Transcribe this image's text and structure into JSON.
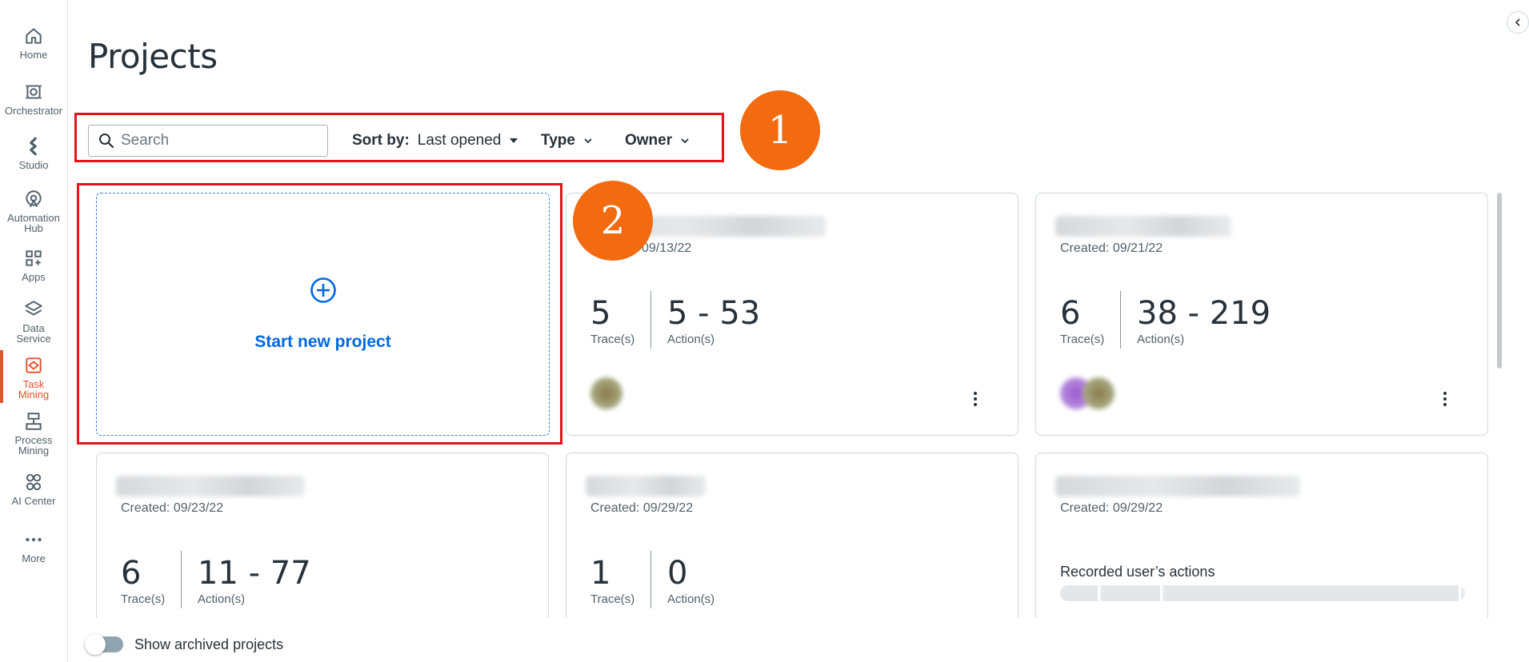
{
  "nav": {
    "items": [
      {
        "label": "Home",
        "icon": "home-icon"
      },
      {
        "label": "Orchestrator",
        "icon": "orchestrator-icon"
      },
      {
        "label": "Studio",
        "icon": "studio-icon"
      },
      {
        "label": "Automation\nHub",
        "icon": "automation-hub-icon"
      },
      {
        "label": "Apps",
        "icon": "apps-icon"
      },
      {
        "label": "Data\nService",
        "icon": "data-service-icon"
      },
      {
        "label": "Task\nMining",
        "icon": "task-mining-icon"
      },
      {
        "label": "Process\nMining",
        "icon": "process-mining-icon"
      },
      {
        "label": "AI Center",
        "icon": "ai-center-icon"
      },
      {
        "label": "More",
        "icon": "more-icon"
      }
    ],
    "active": "Task Mining",
    "accent_color": "#e0542b"
  },
  "page": {
    "title": "Projects"
  },
  "filters": {
    "search_placeholder": "Search",
    "sort_label": "Sort by:",
    "sort_value": "Last opened",
    "type_label": "Type",
    "owner_label": "Owner"
  },
  "annotations": {
    "badge_1": "1",
    "badge_2": "2",
    "highlight_color": "#e8121c",
    "badge_color": "#f26b10"
  },
  "new_project": {
    "label": "Start new project",
    "icon": "plus-circle-icon"
  },
  "projects": [
    {
      "created": "09/13/22",
      "traces": "5",
      "traces_label": "Trace(s)",
      "actions": "5 - 53",
      "actions_label": "Action(s)"
    },
    {
      "created": "Created: 09/21/22",
      "traces": "6",
      "traces_label": "Trace(s)",
      "actions": "38 - 219",
      "actions_label": "Action(s)"
    },
    {
      "created": "Created: 09/23/22",
      "traces": "6",
      "traces_label": "Trace(s)",
      "actions": "11 - 77",
      "actions_label": "Action(s)"
    },
    {
      "created": "Created: 09/29/22",
      "traces": "1",
      "traces_label": "Trace(s)",
      "actions": "0",
      "actions_label": "Action(s)"
    },
    {
      "created": "Created: 09/29/22",
      "recorded_label": "Recorded user’s actions"
    }
  ],
  "footer": {
    "toggle_label": "Show archived projects"
  }
}
